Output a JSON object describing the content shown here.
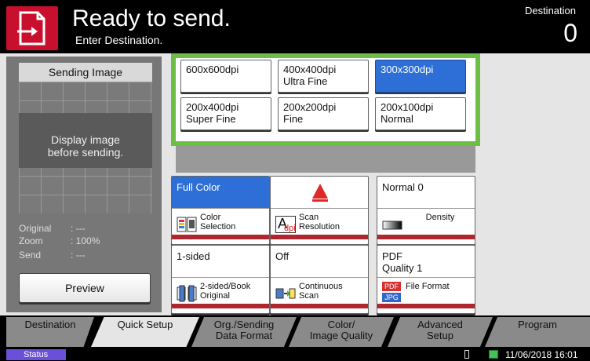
{
  "header": {
    "title": "Ready to send.",
    "subtitle": "Enter Destination.",
    "destination_label": "Destination",
    "destination_count": "0",
    "icon": "send-icon"
  },
  "preview": {
    "header": "Sending Image",
    "message_line1": "Display image",
    "message_line2": "before sending.",
    "rows": [
      {
        "key": "Original",
        "value": ": ---"
      },
      {
        "key": "Zoom",
        "value": ": 100%"
      },
      {
        "key": "Send",
        "value": ": ---"
      }
    ],
    "button": "Preview"
  },
  "resolution": {
    "options": [
      {
        "line1": "600x600dpi",
        "line2": "",
        "selected": false
      },
      {
        "line1": "400x400dpi",
        "line2": "Ultra Fine",
        "selected": false
      },
      {
        "line1": "300x300dpi",
        "line2": "",
        "selected": true
      },
      {
        "line1": "200x400dpi",
        "line2": "Super Fine",
        "selected": false
      },
      {
        "line1": "200x200dpi",
        "line2": "Fine",
        "selected": false
      },
      {
        "line1": "200x100dpi",
        "line2": "Normal",
        "selected": false
      }
    ],
    "popup_color": "#6dbe45",
    "selected_color": "#2d6fd6"
  },
  "tiles": [
    {
      "value": "Full Color",
      "value2": "",
      "label": "Color Selection",
      "icon": "color-selection-icon",
      "selected": true
    },
    {
      "value": "",
      "value2": "",
      "label": "Scan Resolution",
      "icon": "scan-resolution-icon",
      "selected": false
    },
    {
      "value": "Normal 0",
      "value2": "",
      "label": "Density",
      "icon": "density-icon",
      "selected": false
    },
    {
      "value": "1-sided",
      "value2": "",
      "label": "2-sided/Book Original",
      "icon": "duplex-original-icon",
      "selected": false
    },
    {
      "value": "Off",
      "value2": "",
      "label": "Continuous Scan",
      "icon": "continuous-scan-icon",
      "selected": false
    },
    {
      "value": "PDF",
      "value2": "Quality 1",
      "label": "File Format",
      "icon": "file-format-icon",
      "selected": false
    }
  ],
  "tile_labels": {
    "color1": "Color",
    "color2": "Selection",
    "scan1": "Scan",
    "scan2": "Resolution",
    "density": "Density",
    "duplex1": "2-sided/Book",
    "duplex2": "Original",
    "cont1": "Continuous",
    "cont2": "Scan",
    "format": "File Format",
    "dpi_glyph": "A",
    "dpi_text": "dpi",
    "pdf_badge": "PDF",
    "jpg_badge": "JPG"
  },
  "tabs": [
    {
      "line1": "Destination",
      "line2": "",
      "active": false
    },
    {
      "line1": "Quick Setup",
      "line2": "",
      "active": true
    },
    {
      "line1": "Org./Sending",
      "line2": "Data Format",
      "active": false
    },
    {
      "line1": "Color/",
      "line2": "Image Quality",
      "active": false
    },
    {
      "line1": "Advanced",
      "line2": "Setup",
      "active": false
    },
    {
      "line1": "Program",
      "line2": "",
      "active": false
    }
  ],
  "status": {
    "button": "Status",
    "datetime": "11/06/2018  16:01"
  }
}
